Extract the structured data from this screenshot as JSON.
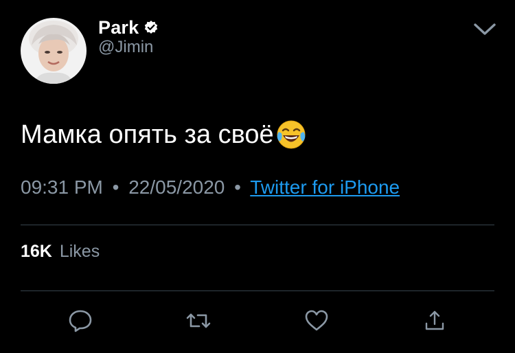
{
  "user": {
    "display_name": "Park",
    "handle": "@Jimin",
    "verified": true,
    "avatar_icon": "avatar-photo"
  },
  "tweet": {
    "text": "Мамка опять за своё",
    "emoji": "face-with-tears-of-joy"
  },
  "meta": {
    "time": "09:31 PM",
    "separator": "•",
    "date": "22/05/2020",
    "source": "Twitter for iPhone"
  },
  "stats": {
    "likes_count": "16K",
    "likes_label": "Likes"
  },
  "actions": {
    "reply_icon": "reply-icon",
    "retweet_icon": "retweet-icon",
    "like_icon": "heart-icon",
    "share_icon": "share-icon"
  },
  "colors": {
    "background": "#000000",
    "text_primary": "#ffffff",
    "text_secondary": "#8b98a5",
    "link": "#1d9bf0",
    "divider": "#38444d"
  }
}
